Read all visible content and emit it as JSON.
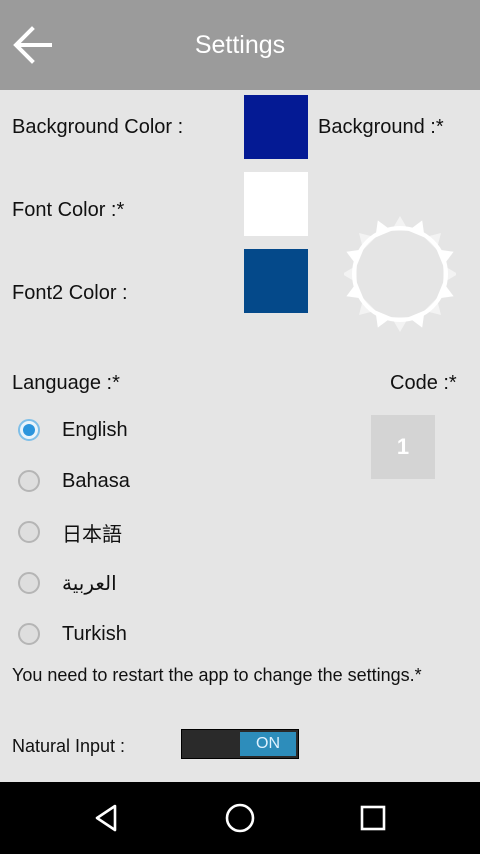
{
  "header": {
    "title": "Settings",
    "back_icon": "arrow-left-icon"
  },
  "colors": {
    "background_label": "Background Color :",
    "background_value": "#041a94",
    "font_label": "Font Color :*",
    "font_value": "#ffffff",
    "font2_label": "Font2 Color :",
    "font2_value": "#04498a",
    "background_pattern_label": "Background :*"
  },
  "language": {
    "label": "Language :*",
    "options": [
      {
        "label": "English",
        "selected": true
      },
      {
        "label": "Bahasa",
        "selected": false
      },
      {
        "label": "日本語",
        "selected": false
      },
      {
        "label": "العربية",
        "selected": false
      },
      {
        "label": "Turkish",
        "selected": false
      }
    ]
  },
  "code": {
    "label": "Code :*",
    "value": "1"
  },
  "note": "You need to restart the app to change the settings.*",
  "natural_input": {
    "label": "Natural Input :",
    "state": "ON"
  },
  "navbar": {
    "icons": [
      "back-triangle-icon",
      "home-circle-icon",
      "recents-square-icon"
    ]
  }
}
